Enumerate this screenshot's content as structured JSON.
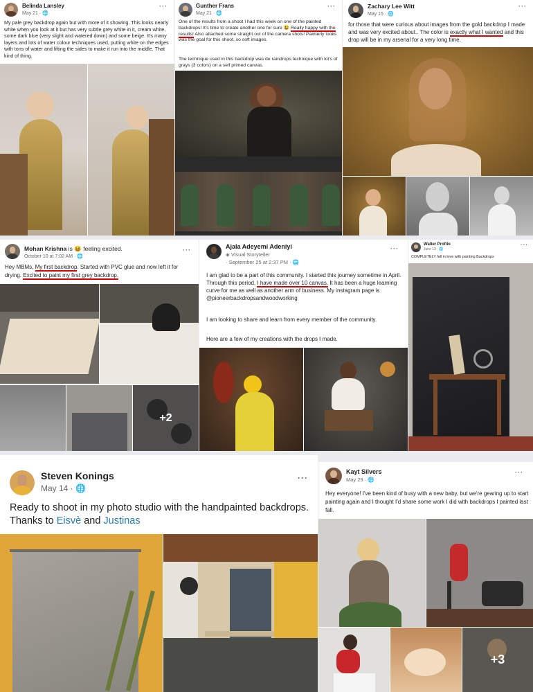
{
  "posts": [
    {
      "author": "Belinda Lansley",
      "date": "May 21 · ",
      "text_pre": "My pale grey backdrop again but with more of it showing.  This looks nearly white when you look at it but has very subtle grey white in it, cream white, some dark blue (very slight and watered down) and some beige.  It's many layers and lots of water colour techniques used, putting white on the edges with tons of water and lifting the sides to make it run into the middle.  That kind of thing."
    },
    {
      "author": "Gunther Frans",
      "date": "May 21 · ",
      "text_1": "One of the results from a shoot I had this week on one of the painted backdrops! It's time to create another one for sure 😃 ",
      "text_u1": "Really happy with the results!",
      "text_2": " Also attached some straight out of the camera shots! Painterly looks was the goal for this shoot, so soft images.",
      "text_3": "The technique used in this backdrop was de raindrops technique with lot's of grays (3 colors) on a self primed canvas."
    },
    {
      "author": "Zachary Lee Witt",
      "date": "May 15 · ",
      "text_1": "for those that were curious about images from the gold backdrop I made and was very excited about..  The color is ",
      "text_u1": "exactly what I wanted",
      "text_2": " and this drop will be in my arsenal for a very long time."
    },
    {
      "author": "Mohan Krishna",
      "feeling": " is 😆 feeling excited.",
      "date": "October 10 at 7:02 AM · ",
      "text_1": "Hey MBMs, ",
      "text_u1": "My first backdrop",
      "text_2": ". Started with PVC glue and now left it for drying. ",
      "text_u2": "Excited to paint my first grey backdrop.",
      "more": "+2"
    },
    {
      "author": "Ajala Adeyemi Adeniyi",
      "badge": "Visual Storyteller",
      "date": "· September 25 at 2:37 PM · ",
      "text_1": "I am glad to be a part of this community. I started this journey sometime in April. Through this period, ",
      "text_u1": "I have made over 10 canvas.",
      "text_2": " It has been a huge learning curve for me as well as another arm of business. My instagram page is @pioneerbackdropsandwoodworking",
      "text_3": "I am looking to share and learn from every member of the community.",
      "text_4": "Here are a few of my creations with the drops I made."
    },
    {
      "author": "Walter Profilo",
      "date": "June 13 · ",
      "text_1": "COMPLETELY fall in love with painting Backdrops"
    },
    {
      "author": "Steven Konings",
      "date": "May 14 · ",
      "text_1": "Ready to shoot in my photo studio with the handpainted backdrops. Thanks to ",
      "link_1": "Eisvè",
      "and": " and ",
      "link_2": "Justinas"
    },
    {
      "author": "Kayt Silvers",
      "date": "May 29 · ",
      "text_1": "Hey everyone! I've been kind of busy with a new baby, but we're gearing up to start painting again and I thought I'd share some work I did with backdrops I painted last fall.",
      "more": "+3"
    }
  ],
  "icons": {
    "privacy": "globe-icon",
    "options": "more-options-icon"
  },
  "dots_label": "···"
}
